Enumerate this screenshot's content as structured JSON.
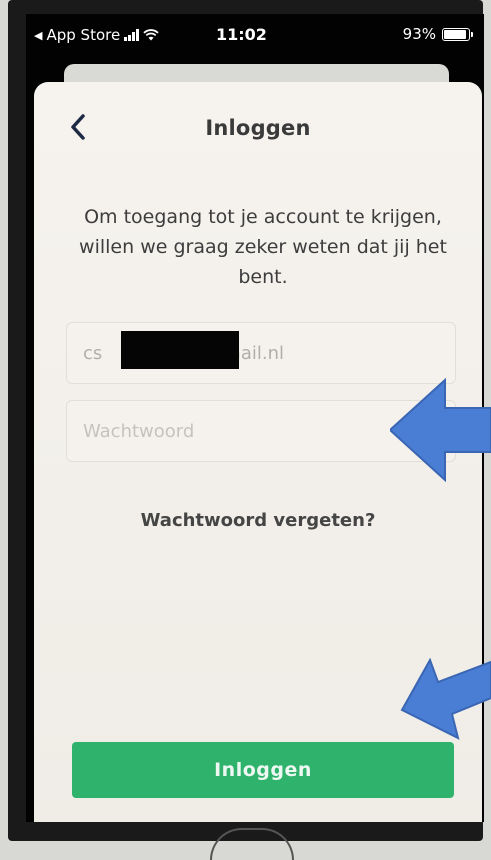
{
  "status_bar": {
    "back_app": "App Store",
    "time": "11:02",
    "battery": "93%"
  },
  "header": {
    "title": "Inloggen"
  },
  "intro_text": "Om toegang tot je account te krijgen, willen we graag zeker weten dat jij het bent.",
  "email": {
    "prefix": "cs",
    "suffix": "mail.nl"
  },
  "password": {
    "placeholder": "Wachtwoord"
  },
  "forgot_link": "Wachtwoord vergeten?",
  "login_button": "Inloggen",
  "colors": {
    "accent_green": "#2fb26c",
    "annotation_arrow": "#4a7dd4"
  }
}
